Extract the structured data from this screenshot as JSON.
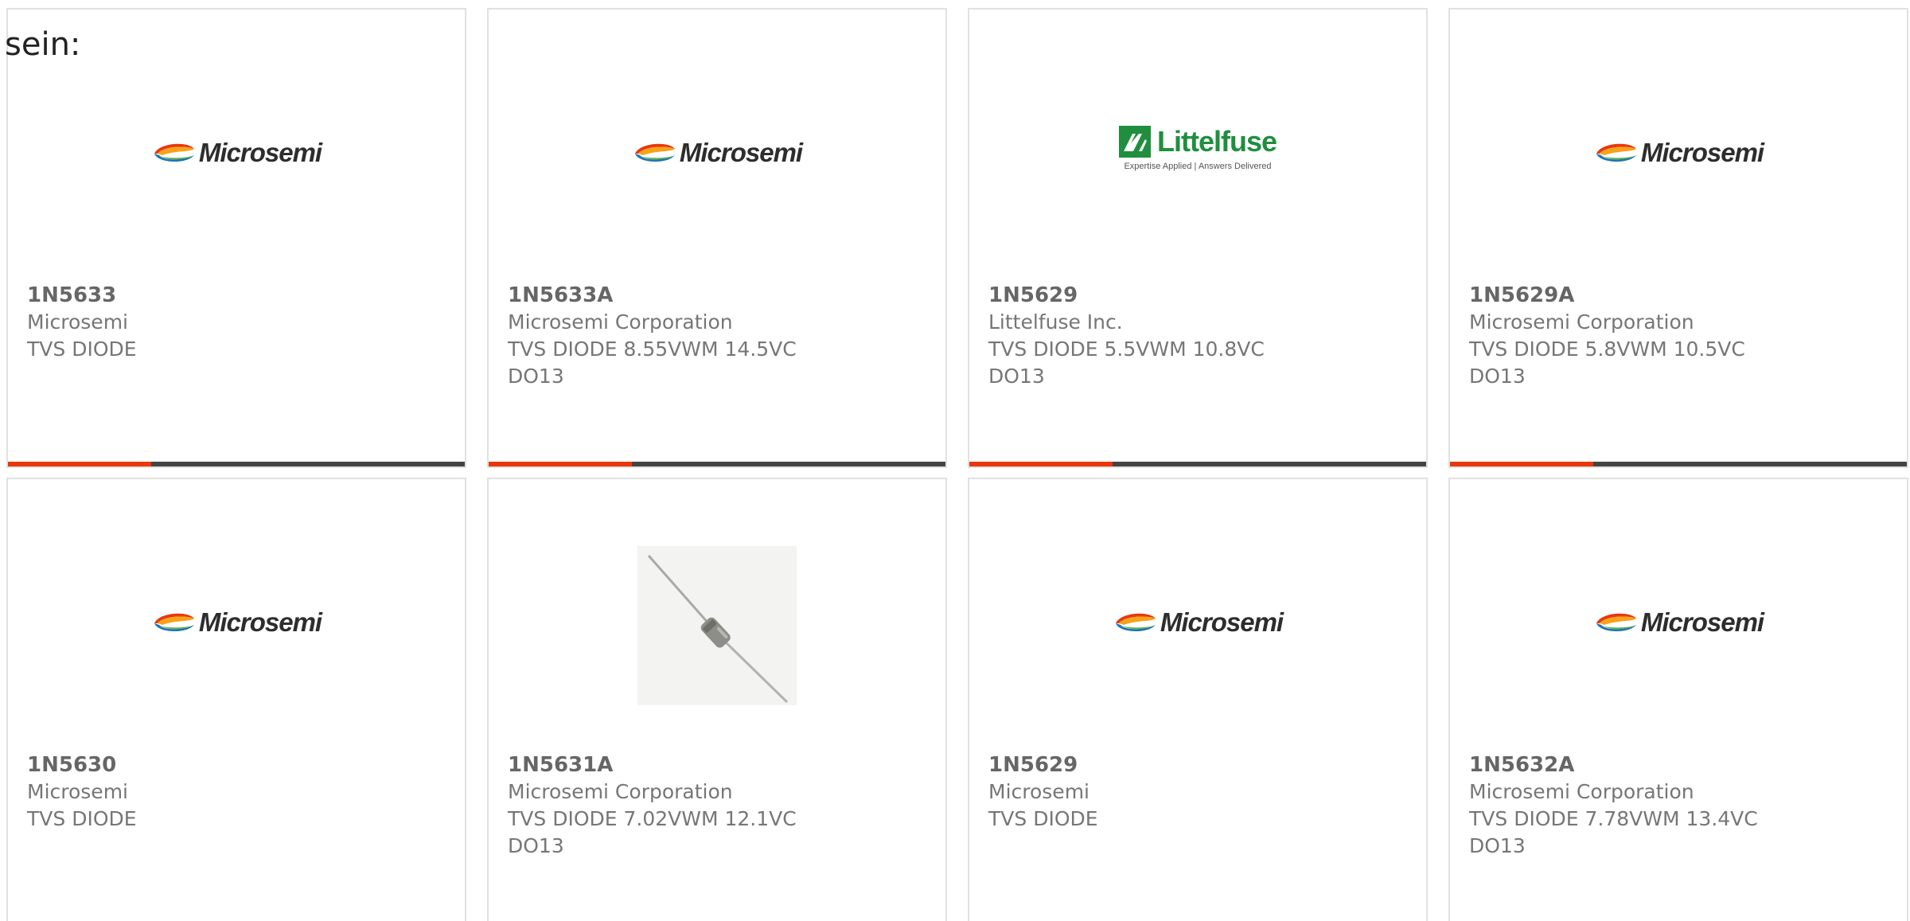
{
  "intro": {
    "text": "sein:"
  },
  "brand": {
    "accent_color": "#e8380d",
    "bar_color": "#444444",
    "littelfuse_color": "#1f8f3e"
  },
  "products": [
    {
      "part": "1N5633",
      "manufacturer": "Microsemi",
      "description": "TVS DIODE",
      "package": "",
      "image": "microsemi-logo",
      "logo_text": "Microsemi"
    },
    {
      "part": "1N5633A",
      "manufacturer": "Microsemi Corporation",
      "description": "TVS DIODE 8.55VWM 14.5VC",
      "package": "DO13",
      "image": "microsemi-logo",
      "logo_text": "Microsemi"
    },
    {
      "part": "1N5629",
      "manufacturer": "Littelfuse Inc.",
      "description": "TVS DIODE 5.5VWM 10.8VC",
      "package": "DO13",
      "image": "littelfuse-logo",
      "logo_text": "Littelfuse",
      "logo_tagline": "Expertise Applied | Answers Delivered"
    },
    {
      "part": "1N5629A",
      "manufacturer": "Microsemi Corporation",
      "description": "TVS DIODE 5.8VWM 10.5VC",
      "package": "DO13",
      "image": "microsemi-logo",
      "logo_text": "Microsemi"
    },
    {
      "part": "1N5630",
      "manufacturer": "Microsemi",
      "description": "TVS DIODE",
      "package": "",
      "image": "microsemi-logo",
      "logo_text": "Microsemi"
    },
    {
      "part": "1N5631A",
      "manufacturer": "Microsemi Corporation",
      "description": "TVS DIODE 7.02VWM 12.1VC",
      "package": "DO13",
      "image": "diode-photo"
    },
    {
      "part": "1N5629",
      "manufacturer": "Microsemi",
      "description": "TVS DIODE",
      "package": "",
      "image": "microsemi-logo",
      "logo_text": "Microsemi"
    },
    {
      "part": "1N5632A",
      "manufacturer": "Microsemi Corporation",
      "description": "TVS DIODE 7.78VWM 13.4VC",
      "package": "DO13",
      "image": "microsemi-logo",
      "logo_text": "Microsemi"
    }
  ]
}
